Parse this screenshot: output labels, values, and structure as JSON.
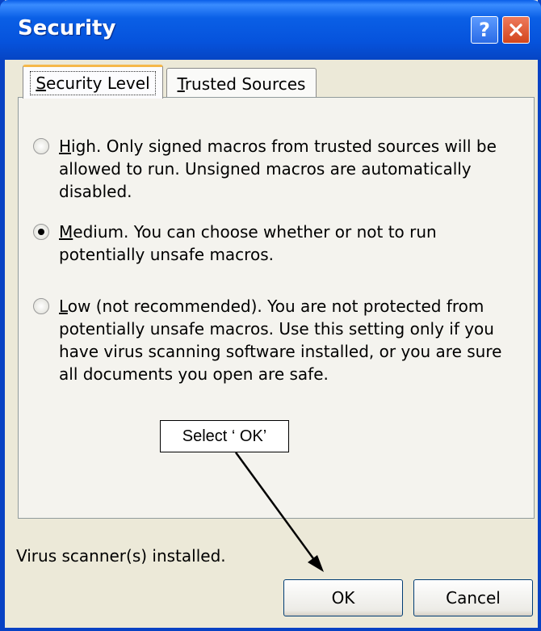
{
  "window": {
    "title": "Security"
  },
  "title_buttons": {
    "help": "?",
    "help_icon": "help-icon",
    "close_icon": "close-icon"
  },
  "tabs": [
    {
      "label": "Security Level",
      "mnemonic": "S",
      "rest": "ecurity Level",
      "active": true
    },
    {
      "label": "Trusted Sources",
      "mnemonic": "T",
      "rest": "rusted Sources",
      "active": false
    }
  ],
  "options": [
    {
      "mnemonic": "H",
      "text_rest": "igh. Only signed macros from trusted sources will be allowed to run. Unsigned macros are automatically disabled.",
      "checked": false
    },
    {
      "mnemonic": "M",
      "text_rest": "edium. You can choose whether or not to run potentially unsafe macros.",
      "checked": true
    },
    {
      "mnemonic": "L",
      "text_rest": "ow (not recommended). You are not protected from potentially unsafe macros. Use this setting only if you have virus scanning software installed, or you are sure all documents you open are safe.",
      "checked": false
    }
  ],
  "annotation": {
    "text": "Select ‘ OK’"
  },
  "status": {
    "text": "Virus scanner(s) installed."
  },
  "buttons": {
    "ok": "OK",
    "cancel": "Cancel"
  },
  "colors": {
    "title_bar": "#0653dc",
    "dialog_face": "#ece9d8",
    "close_button": "#d2451c"
  }
}
